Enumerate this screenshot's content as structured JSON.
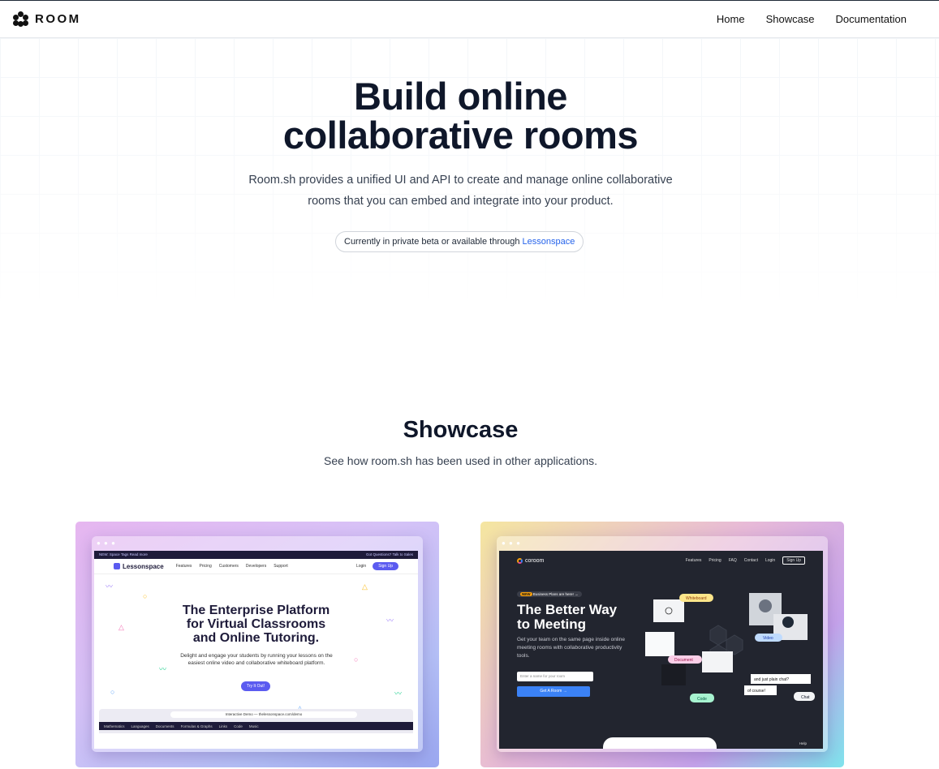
{
  "nav": {
    "logo_text": "ROOM",
    "links": [
      "Home",
      "Showcase",
      "Documentation"
    ]
  },
  "hero": {
    "title_line1": "Build online",
    "title_line2": "collaborative rooms",
    "subtitle_line1": "Room.sh provides a unified UI and API to create and manage online collaborative",
    "subtitle_line2": "rooms that you can embed and integrate into your product.",
    "pill_text": "Currently in private beta or available through",
    "pill_link": "Lessonspace"
  },
  "showcase": {
    "title": "Showcase",
    "subtitle": "See how room.sh has been used in other applications.",
    "lessonspace": {
      "banner_left": "NEW: Space Tags Read more",
      "banner_right": "Got Questions? Talk to Sales",
      "brand": "Lessonspace",
      "nav": [
        "Features",
        "Pricing",
        "Customers",
        "Developers",
        "Support"
      ],
      "login": "Login",
      "signup": "Sign Up",
      "headline1": "The Enterprise Platform",
      "headline2": "for Virtual Classrooms",
      "headline3": "and Online Tutoring.",
      "body": "Delight and engage your students by running your lessons on the easiest online video and collaborative whiteboard platform.",
      "cta": "Try It Out!",
      "demo_bar": "Interactive Demo — thelessonspace.com/demo",
      "tabs": [
        "Mathematics",
        "Languages",
        "Documents",
        "Formulas & Graphs",
        "Links",
        "Code",
        "Music"
      ]
    },
    "coroom": {
      "brand": "coroom",
      "nav": [
        "Features",
        "Pricing",
        "FAQ",
        "Contact",
        "Login"
      ],
      "signup": "Sign Up",
      "badge_new": "NEW",
      "badge_text": "Business Plans are here! →",
      "headline1": "The Better Way",
      "headline2": "to Meeting",
      "body": "Get your team on the same page inside online meeting rooms with collaborative productivity tools.",
      "input_placeholder": "Enter a name for your room",
      "cta": "Get A Room →",
      "chips": [
        "Whiteboard",
        "Video",
        "Document",
        "Code",
        "Chat"
      ],
      "chat1": "and just plain chat?",
      "chat2": "of course!",
      "help": "Help"
    }
  }
}
